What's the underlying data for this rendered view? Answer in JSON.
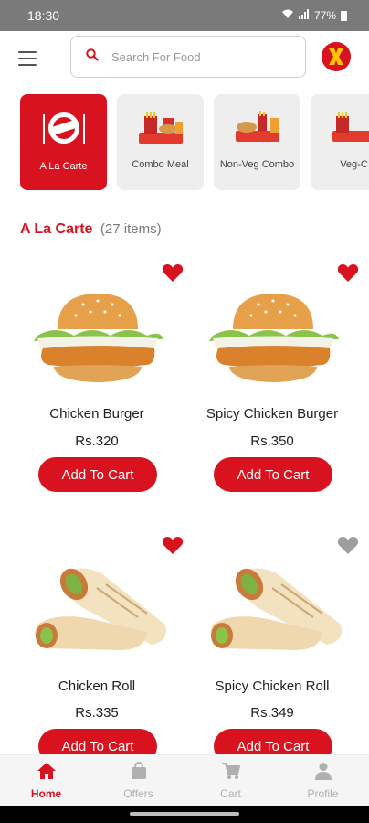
{
  "status_bar": {
    "time": "18:30",
    "battery": "77%"
  },
  "search": {
    "placeholder": "Search For Food"
  },
  "categories": [
    {
      "label": "A La Carte",
      "active": true,
      "badge": "A LA CARTE"
    },
    {
      "label": "Combo Meal",
      "active": false
    },
    {
      "label": "Non-Veg Combo",
      "active": false
    },
    {
      "label": "Veg-C",
      "active": false
    }
  ],
  "section": {
    "title": "A La Carte",
    "count": "(27 items)"
  },
  "products": [
    {
      "name": "Chicken Burger",
      "price": "Rs.320",
      "button": "Add To Cart",
      "favorite": true
    },
    {
      "name": "Spicy Chicken Burger",
      "price": "Rs.350",
      "button": "Add To Cart",
      "favorite": true
    },
    {
      "name": "Chicken Roll",
      "price": "Rs.335",
      "button": "Add To Cart",
      "favorite": true
    },
    {
      "name": "Spicy Chicken Roll",
      "price": "Rs.349",
      "button": "Add To Cart",
      "favorite": false
    }
  ],
  "bottom_nav": [
    {
      "label": "Home",
      "icon": "home-icon",
      "active": true
    },
    {
      "label": "Offers",
      "icon": "shopping-bag-icon",
      "active": false
    },
    {
      "label": "Cart",
      "icon": "cart-icon",
      "active": false
    },
    {
      "label": "Profile",
      "icon": "person-icon",
      "active": false
    }
  ],
  "colors": {
    "accent": "#d8131f",
    "favorite_on": "#d8131f",
    "favorite_off": "#9e9e9e",
    "nav_inactive": "#b0b0b0"
  }
}
